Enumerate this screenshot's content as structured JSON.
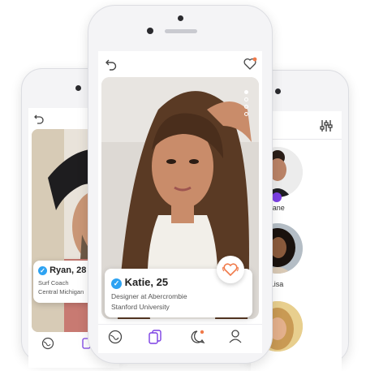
{
  "profiles": {
    "main": {
      "name_age": "Katie, 25",
      "line1": "Designer at Abercrombie",
      "line2": "Stanford University"
    },
    "left": {
      "name_age": "Ryan, 28",
      "line1": "Surf Coach",
      "line2": "Central Michigan"
    }
  },
  "list": [
    {
      "name": "Jane"
    },
    {
      "name": "Lisa"
    }
  ],
  "colors": {
    "accent": "#7b3fe4",
    "like": "#f07a4a",
    "verified": "#2ea3f2"
  },
  "icons": [
    "undo-icon",
    "heart-notification-icon",
    "globe-icon",
    "cards-icon",
    "chat-icon",
    "profile-icon",
    "filter-icon",
    "heart-like-icon"
  ]
}
